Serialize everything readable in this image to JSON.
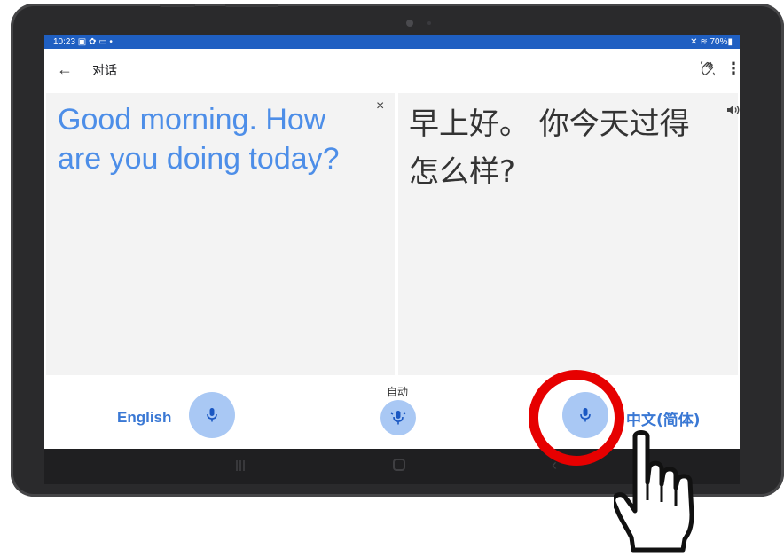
{
  "status_bar": {
    "time_icons": "10:23 ▣ ✿ ▭ •",
    "right_status": "✕ ≋ 70%▮"
  },
  "app_bar": {
    "back_glyph": "←",
    "title": "对话",
    "more_glyph": "⋮"
  },
  "source_panel": {
    "text": "Good morning. How are you doing today?",
    "close_glyph": "×"
  },
  "target_panel": {
    "text": "早上好。 你今天过得怎么样?"
  },
  "bottom_bar": {
    "left_language": "English",
    "auto_label": "自动",
    "right_language": "中文(简体)"
  },
  "colors": {
    "status_bar": "#1f5fc2",
    "accent_blue": "#4d8ee8",
    "mic_button": "#a9c8f4",
    "highlight_ring": "#e60000"
  },
  "icons": [
    "back-icon",
    "hand-wave-icon",
    "more-icon",
    "close-icon",
    "speaker-icon",
    "mic-icon",
    "auto-mic-icon",
    "pointing-hand-icon"
  ]
}
